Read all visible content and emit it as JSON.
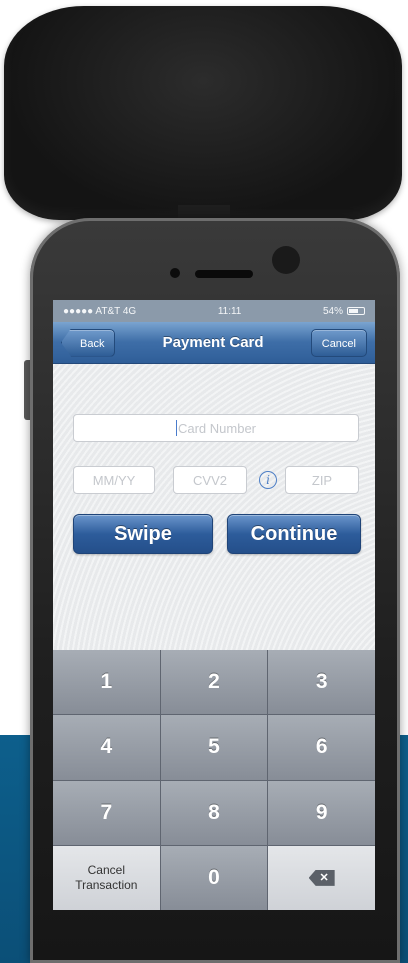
{
  "status_bar": {
    "carrier": "●●●●● AT&T  4G",
    "time": "11:11",
    "battery": "54%",
    "battery_level": 0.54
  },
  "nav": {
    "back_label": "Back",
    "title": "Payment Card",
    "cancel_label": "Cancel"
  },
  "form": {
    "card_number_placeholder": "Card Number",
    "expiry_placeholder": "MM/YY",
    "cvv_placeholder": "CVV2",
    "info_icon": "info-icon",
    "zip_placeholder": "ZIP"
  },
  "buttons": {
    "swipe_label": "Swipe",
    "continue_label": "Continue"
  },
  "keypad": {
    "keys": [
      "1",
      "2",
      "3",
      "4",
      "5",
      "6",
      "7",
      "8",
      "9"
    ],
    "cancel_line1": "Cancel",
    "cancel_line2": "Transaction",
    "zero": "0",
    "backspace_icon": "backspace-icon"
  },
  "colors": {
    "accent": "#2f5e98",
    "background_band": "#0d5f8c"
  }
}
